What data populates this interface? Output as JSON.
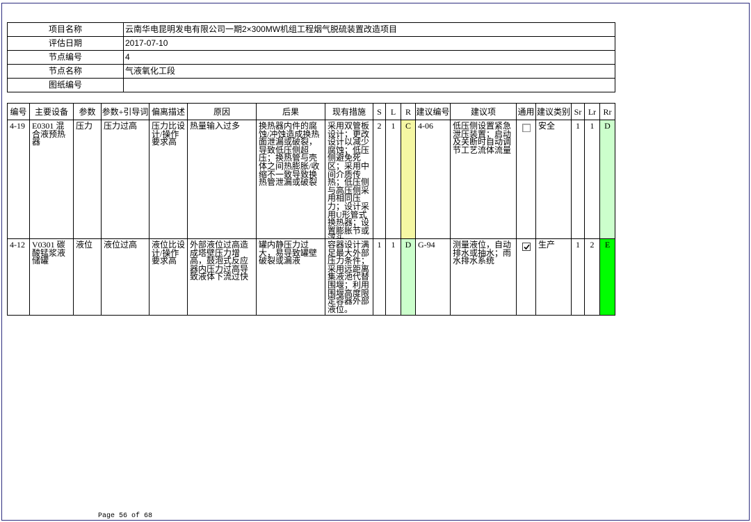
{
  "project_info": [
    {
      "label": "项目名称",
      "value": "云南华电昆明发电有限公司一期2×300MW机组工程烟气脱硫装置改造项目"
    },
    {
      "label": "评估日期",
      "value": "2017-07-10"
    },
    {
      "label": "节点编号",
      "value": "4"
    },
    {
      "label": "节点名称",
      "value": "气液氧化工段"
    },
    {
      "label": "图纸编号",
      "value": ""
    }
  ],
  "hazop_table": {
    "headers": [
      "编号",
      "主要设备",
      "参数",
      "参数+引导词",
      "偏离描述",
      "原因",
      "后果",
      "现有措施",
      "S",
      "L",
      "R",
      "建议编号",
      "建议项",
      "通用",
      "建议类别",
      "Sr",
      "Lr",
      "Rr"
    ],
    "rows": [
      {
        "id": "4-19",
        "equipment": "E0301 混合液预热器",
        "parameter": "压力",
        "param_guideword": "压力过高",
        "deviation": "压力比设计/操作要求高",
        "cause": "热量输入过多",
        "consequence": "换热器内件的腐蚀/冲蚀造成换热面泄漏或破裂，导致低压侧超压；换热管与壳体之间热膨胀/收缩不一致导致换热管泄漏或破裂",
        "safeguards": "采用双管板设计；更改设计以减少腐蚀；低压侧避免死区；采用中间介质传热；低压侧与高压侧采用相同压力；设计采用U形管式换热器；设置膨胀节或浮头",
        "s": "2",
        "l": "1",
        "r": "C",
        "r_color": "#f5f7a3",
        "rec_id": "4-06",
        "recommendation": "低压侧设置紧急泄压装置；启动及关断时自动调节工艺流体流量",
        "general": false,
        "rec_category": "安全",
        "sr": "1",
        "lr": "1",
        "rr": "D",
        "rr_color": "#ccffcc"
      },
      {
        "id": "4-12",
        "equipment": "V0301 碳酸锰浆液储罐",
        "parameter": "液位",
        "param_guideword": "液位过高",
        "deviation": "液位比设计/操作要求高",
        "cause": "外部液位过高造成塔壁压力增高，鼓泡式反应器内压力过高导致液体下流过快",
        "consequence": "罐内静压力过大，易导致罐壁破裂或漏液",
        "safeguards": "容器设计满足最大外部压力条件；采用远距离集液池代替围堰；利用围堰高度限定容器外部液位。",
        "s": "1",
        "l": "1",
        "r": "D",
        "r_color": "#ccffcc",
        "rec_id": "G-94",
        "recommendation": "测量液位，自动排水或抽水；雨水排水系统",
        "general": true,
        "rec_category": "生产",
        "sr": "1",
        "lr": "2",
        "rr": "E",
        "rr_color": "#00ff00"
      }
    ]
  },
  "footer": {
    "page_label": "Page 56 of 68"
  }
}
